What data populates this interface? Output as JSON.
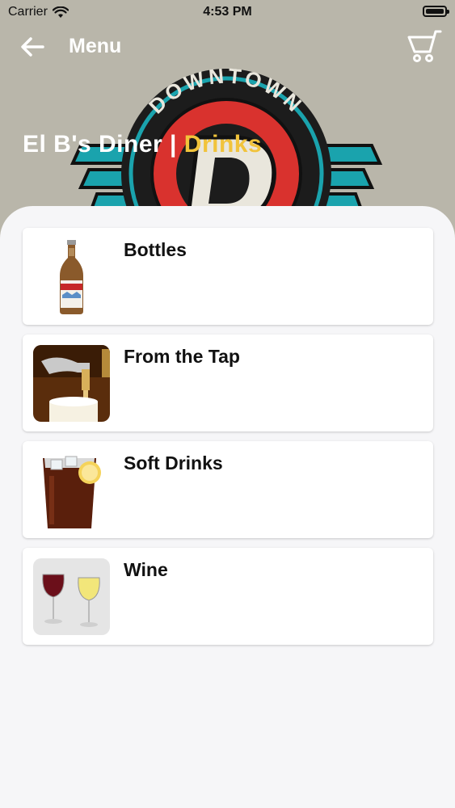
{
  "status": {
    "carrier": "Carrier",
    "time": "4:53 PM"
  },
  "nav": {
    "title": "Menu"
  },
  "hero": {
    "venue": "El B's Diner",
    "separator": "|",
    "section": "Drinks",
    "logo_text": "DOWNTOWN"
  },
  "categories": [
    {
      "label": "Bottles"
    },
    {
      "label": "From the Tap"
    },
    {
      "label": "Soft Drinks"
    },
    {
      "label": "Wine"
    }
  ],
  "icons": {
    "back": "arrow-left-icon",
    "cart": "shopping-cart-icon",
    "wifi": "wifi-icon",
    "battery": "battery-icon"
  },
  "colors": {
    "accent": "#f1c33b",
    "hero_bg": "#b9b6aa",
    "logo_red": "#d9322e",
    "logo_teal": "#1aa3ad"
  }
}
